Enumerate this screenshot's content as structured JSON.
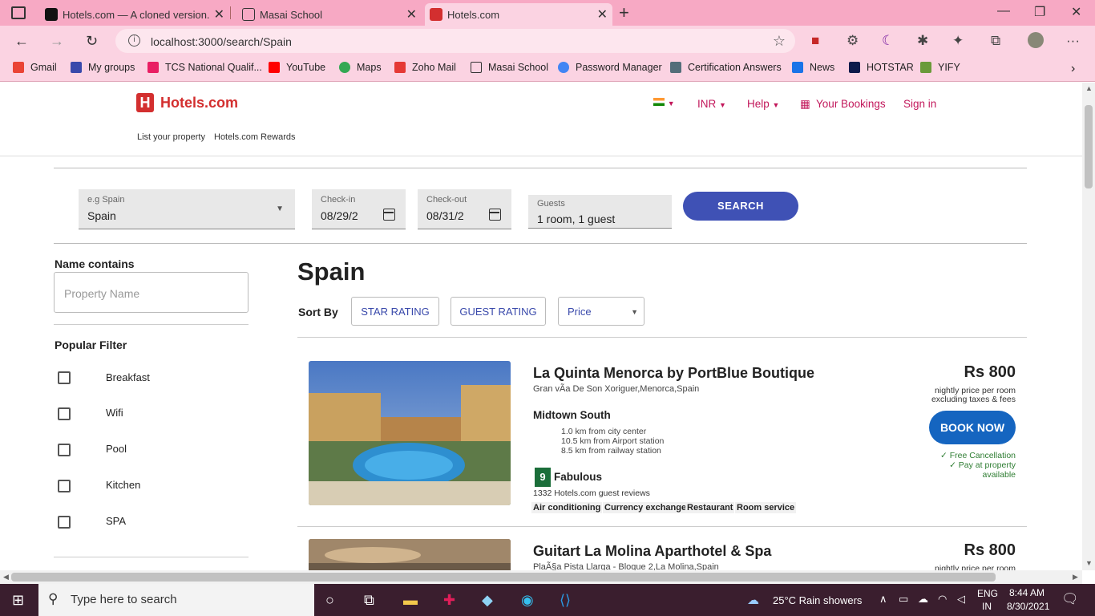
{
  "browser": {
    "tabs": [
      {
        "title": "Hotels.com — A cloned version."
      },
      {
        "title": "Masai School"
      },
      {
        "title": "Hotels.com"
      }
    ],
    "url": "localhost:3000/search/Spain",
    "bookmarks": [
      "Gmail",
      "My groups",
      "TCS National Qualif...",
      "YouTube",
      "Maps",
      "Zoho Mail",
      "Masai School",
      "Password Manager",
      "Certification Answers",
      "News",
      "HOTSTAR",
      "YIFY"
    ]
  },
  "header": {
    "logo": "Hotels.com",
    "currency": "INR",
    "help": "Help",
    "bookings": "Your Bookings",
    "signin": "Sign in",
    "list_property": "List your property",
    "rewards": "Hotels.com Rewards"
  },
  "search": {
    "destination_label": "e.g Spain",
    "destination_value": "Spain",
    "checkin_label": "Check-in",
    "checkin_value": "08/29/2",
    "checkout_label": "Check-out",
    "checkout_value": "08/31/2",
    "guests_label": "Guests",
    "guests_value": "1 room, 1 guest",
    "button": "SEARCH"
  },
  "filters": {
    "name_title": "Name contains",
    "name_placeholder": "Property Name",
    "popular_title": "Popular Filter",
    "options": [
      "Breakfast",
      "Wifi",
      "Pool",
      "Kitchen",
      "SPA"
    ]
  },
  "results": {
    "city": "Spain",
    "sort_label": "Sort By",
    "sort_star": "STAR RATING",
    "sort_guest": "GUEST RATING",
    "sort_price": "Price",
    "hotels": [
      {
        "name": "La Quinta Menorca by PortBlue Boutique",
        "address": "Gran vÃ­a De Son Xoriguer,Menorca,Spain",
        "area": "Midtown South",
        "dist1": "1.0 km from city center",
        "dist2": "10.5 km from Airport station",
        "dist3": "8.5 km from railway station",
        "rating": "9",
        "rating_text": "Fabulous",
        "reviews": "1332 Hotels.com guest reviews",
        "amenities": [
          "Air conditioning",
          "Currency exchange",
          "Restaurant",
          "Room service"
        ],
        "price": "Rs 800",
        "price_note1": "nightly price per room",
        "price_note2": "excluding taxes & fees",
        "book": "BOOK NOW",
        "perk1": "✓ Free Cancellation",
        "perk2": "✓ Pay at property",
        "perk3": "available"
      },
      {
        "name": "Guitart La Molina Aparthotel & Spa",
        "address": "PlaÃ§a Pista Llarga - Bloque 2,La Molina,Spain",
        "price": "Rs 800",
        "price_note1": "nightly price per room"
      }
    ]
  },
  "taskbar": {
    "search_placeholder": "Type here to search",
    "weather": "25°C  Rain showers",
    "lang1": "ENG",
    "lang2": "IN",
    "time": "8:44 AM",
    "date": "8/30/2021"
  }
}
